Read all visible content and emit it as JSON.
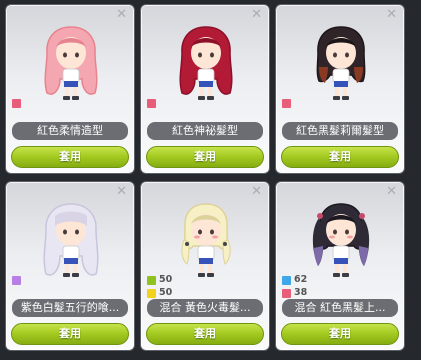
{
  "cards": [
    {
      "name": "紅色柔情造型",
      "apply_label": "套用",
      "hair_color": "#f4a7b0",
      "hair_shade": "#e7838f",
      "swatches": [
        {
          "color": "#e85d7a",
          "percent": ""
        }
      ]
    },
    {
      "name": "紅色神祕髮型",
      "apply_label": "套用",
      "hair_color": "#b21a36",
      "hair_shade": "#8c1029",
      "swatches": [
        {
          "color": "#e85d7a",
          "percent": ""
        }
      ]
    },
    {
      "name": "紅色黑髮莉爾髮型",
      "apply_label": "套用",
      "hair_color": "#2f2528",
      "hair_shade": "#8a3a22",
      "swatches": [
        {
          "color": "#e85d7a",
          "percent": ""
        }
      ]
    },
    {
      "name": "紫色白髮五行的喰...",
      "apply_label": "套用",
      "hair_color": "#e8e6f2",
      "hair_shade": "#c9c3dd",
      "swatches": [
        {
          "color": "#b77ee6",
          "percent": ""
        }
      ]
    },
    {
      "name": "混合 黃色火毒髮...",
      "apply_label": "套用",
      "hair_color": "#f6f0c4",
      "hair_shade": "#ddd39a",
      "swatches": [
        {
          "color": "#8fc21f",
          "percent": "50"
        },
        {
          "color": "#f2d31b",
          "percent": "50"
        }
      ]
    },
    {
      "name": "混合 紅色黑髮上...",
      "apply_label": "套用",
      "hair_color": "#2e2a36",
      "hair_shade": "#7d6aa8",
      "swatches": [
        {
          "color": "#3fa6e8",
          "percent": "62"
        },
        {
          "color": "#e85d7a",
          "percent": "38"
        }
      ]
    }
  ]
}
